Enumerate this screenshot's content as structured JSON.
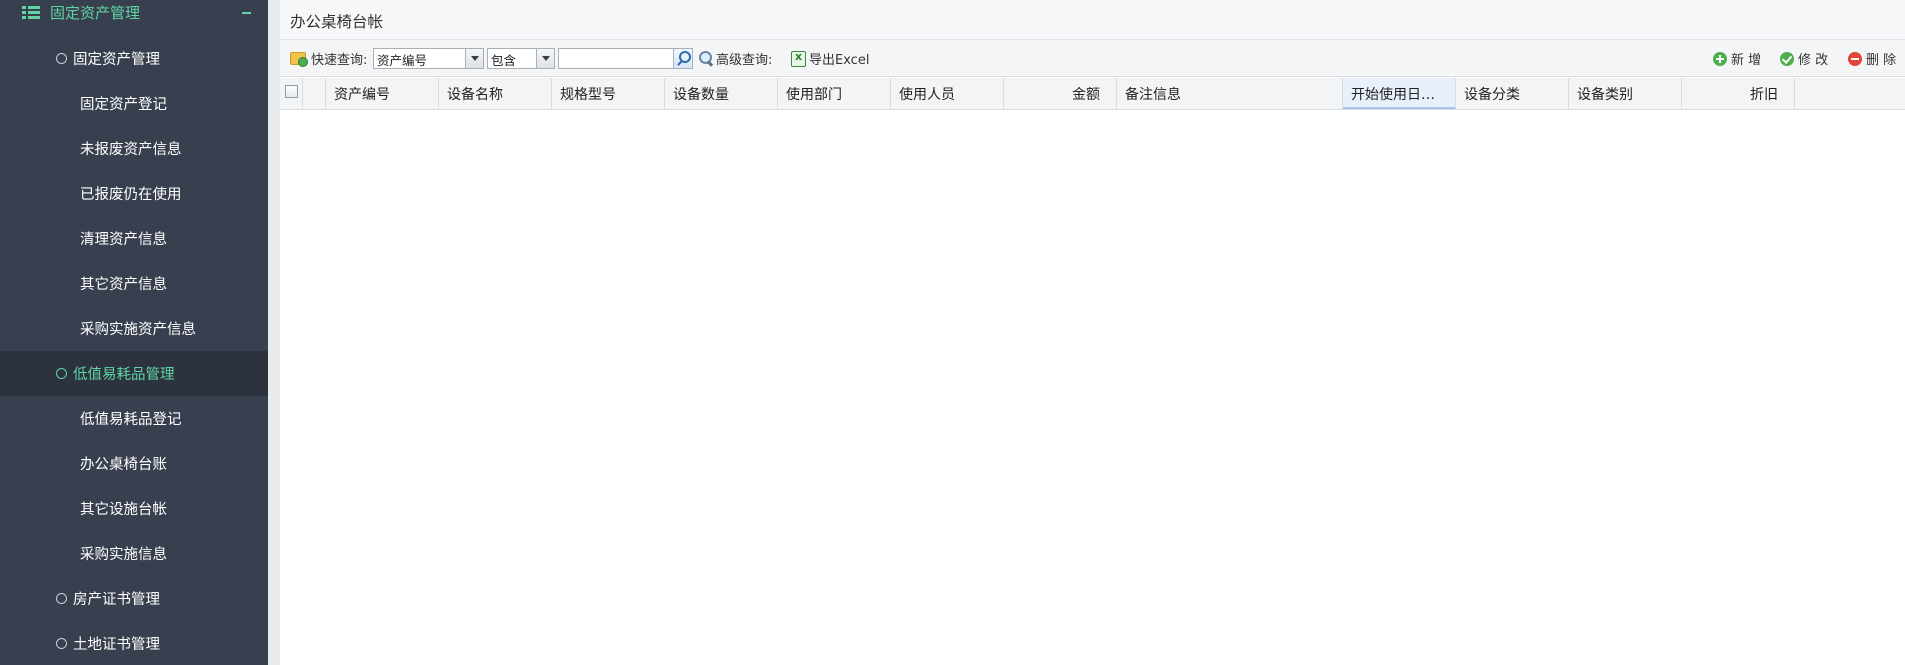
{
  "sidebar": {
    "section_title": "固定资产管理",
    "section_icon": "list-icon",
    "collapse_icon": "minus-icon",
    "groups": [
      {
        "label": "固定资产管理",
        "items": [
          "固定资产登记",
          "未报废资产信息",
          "已报废仍在使用",
          "清理资产信息",
          "其它资产信息",
          "采购实施资产信息"
        ]
      },
      {
        "label": "低值易耗品管理",
        "active": true,
        "items": [
          "低值易耗品登记",
          "办公桌椅台账",
          "其它设施台帐",
          "采购实施信息"
        ]
      },
      {
        "label": "房产证书管理",
        "items": []
      },
      {
        "label": "土地证书管理",
        "items": []
      }
    ],
    "active_color": "#5fd4a4",
    "bg_color": "#38404f"
  },
  "page": {
    "title": "办公桌椅台帐"
  },
  "toolbar": {
    "quick_query_label": "快速查询:",
    "field_select": "资产编号",
    "operator_select": "包含",
    "search_value": "",
    "advanced_query_label": "高级查询:",
    "export_label": "导出Excel",
    "add_label": "新 增",
    "edit_label": "修 改",
    "delete_label": "删 除"
  },
  "grid": {
    "columns": [
      "资产编号",
      "设备名称",
      "规格型号",
      "设备数量",
      "使用部门",
      "使用人员",
      "金额",
      "备注信息",
      "开始使用日…",
      "设备分类",
      "设备类别",
      "折旧"
    ],
    "sorted_column": "开始使用日…",
    "rows": []
  }
}
